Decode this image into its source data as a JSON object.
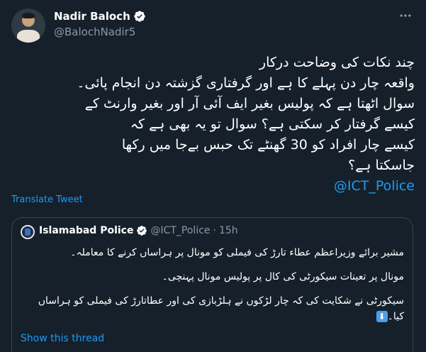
{
  "author": {
    "display_name": "Nadir Baloch",
    "handle": "@BalochNadir5"
  },
  "tweet": {
    "lines": [
      "چند نکات کی وضاحت درکار",
      "واقعہ چار دن پہلے کا ہے اور گرفتاری گزشتہ دن انجام پائی۔",
      "سوال اٹھتا ہے کہ پولیس بغیر ایف آئی آر اور بغیر وارنٹ کے",
      "کیسے گرفتار کر سکتی ہے؟ سوال تو یہ بھی ہے کہ",
      "کیسے چار افراد کو 30 گھنٹے تک حبس بےجا میں رکھا",
      "جاسکتا ہے؟"
    ],
    "mention": "@ICT_Police",
    "translate_label": "Translate Tweet"
  },
  "quoted": {
    "display_name": "Islamabad Police",
    "handle": "@ICT_Police",
    "separator": "·",
    "time": "15h",
    "paragraphs": [
      "مشیر برائے وزیراعظم عطاء تارڑ کی فیملی کو مونال پر ہراساں کرنے کا معاملہ۔",
      "مونال پر تعینات سیکورٹی کی کال پر پولیس مونال پہنچی۔",
      "سیکورٹی نے شکایت کی کہ چار لڑکوں نے ہلڑبازی کی اور عطاتارڑ کی فیملی کو ہراساں کیا۔"
    ],
    "emoji": "⬇",
    "show_thread_label": "Show this thread"
  },
  "icons": {
    "verified": "verified-badge-icon",
    "more": "more-options-icon"
  },
  "colors": {
    "background": "#15202b",
    "accent": "#1d9bf0",
    "muted": "#8b98a5",
    "border": "#38444d"
  }
}
